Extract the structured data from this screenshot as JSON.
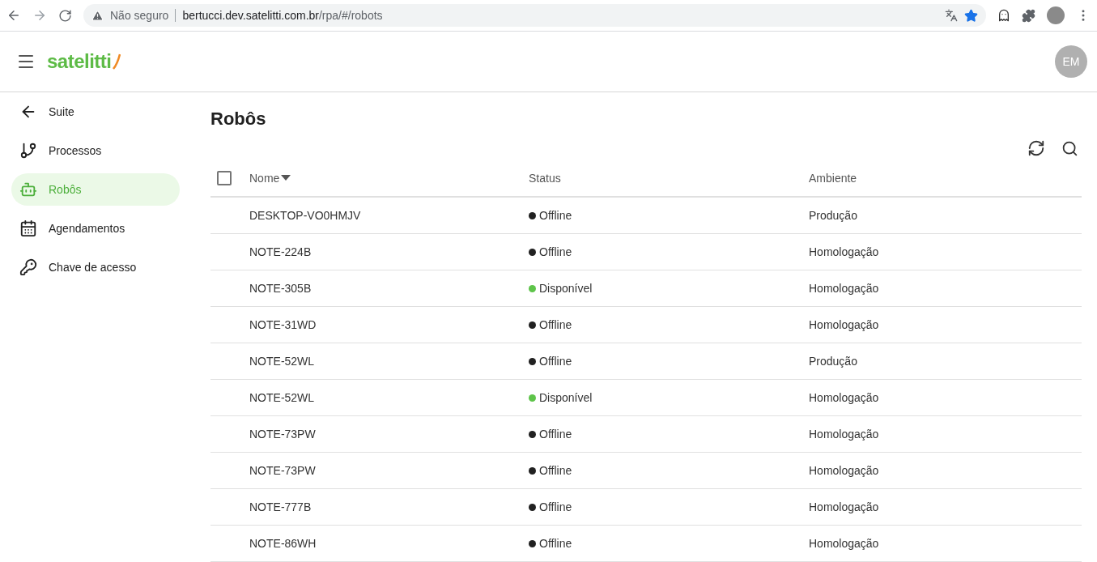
{
  "browser": {
    "security": "Não seguro",
    "url_host": "bertucci.dev.satelitti.com.br",
    "url_path": "/rpa/#/robots"
  },
  "header": {
    "logo": "satelitti",
    "avatar": "EM"
  },
  "sidebar": {
    "items": [
      {
        "label": "Suite",
        "selected": false
      },
      {
        "label": "Processos",
        "selected": false
      },
      {
        "label": "Robôs",
        "selected": true
      },
      {
        "label": "Agendamentos",
        "selected": false
      },
      {
        "label": "Chave de acesso",
        "selected": false
      }
    ]
  },
  "page": {
    "title": "Robôs"
  },
  "table": {
    "select_all": {
      "checked": false
    },
    "columns": [
      "Nome",
      "Status",
      "Ambiente"
    ],
    "rows": [
      {
        "name": "DESKTOP-VO0HMJV",
        "status": "Offline",
        "color": "#212121",
        "environment": "Produção"
      },
      {
        "name": "NOTE-224B",
        "status": "Offline",
        "color": "#212121",
        "environment": "Homologação"
      },
      {
        "name": "NOTE-305B",
        "status": "Disponível",
        "color": "#5ec44a",
        "environment": "Homologação"
      },
      {
        "name": "NOTE-31WD",
        "status": "Offline",
        "color": "#212121",
        "environment": "Homologação"
      },
      {
        "name": "NOTE-52WL",
        "status": "Offline",
        "color": "#212121",
        "environment": "Produção"
      },
      {
        "name": "NOTE-52WL",
        "status": "Disponível",
        "color": "#5ec44a",
        "environment": "Homologação"
      },
      {
        "name": "NOTE-73PW",
        "status": "Offline",
        "color": "#212121",
        "environment": "Homologação"
      },
      {
        "name": "NOTE-73PW",
        "status": "Offline",
        "color": "#212121",
        "environment": "Homologação"
      },
      {
        "name": "NOTE-777B",
        "status": "Offline",
        "color": "#212121",
        "environment": "Homologação"
      },
      {
        "name": "NOTE-86WH",
        "status": "Offline",
        "color": "#212121",
        "environment": "Homologação"
      }
    ]
  }
}
